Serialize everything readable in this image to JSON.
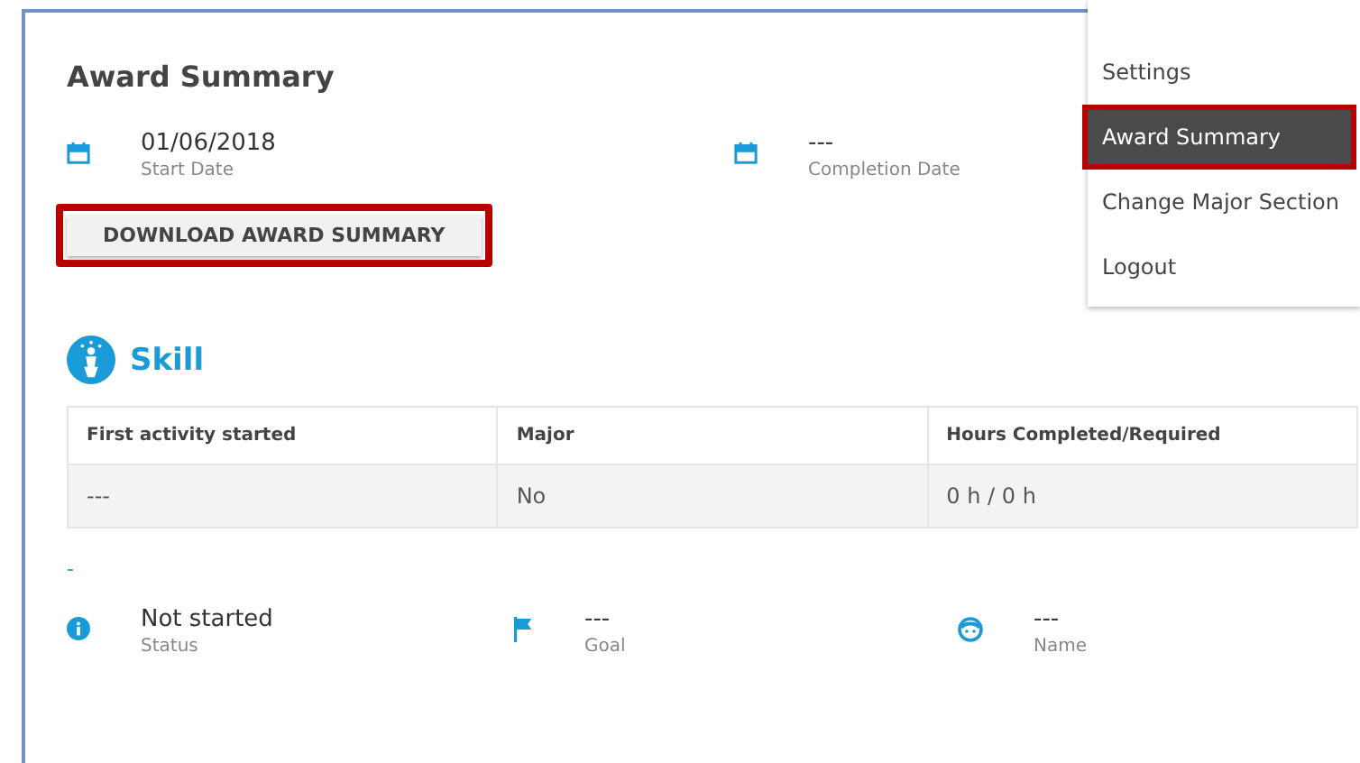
{
  "page": {
    "title": "Award Summary",
    "dates": [
      {
        "value": "01/06/2018",
        "label": "Start Date"
      },
      {
        "value": "---",
        "label": "Completion Date"
      }
    ],
    "download_button": {
      "label": "DOWNLOAD AWARD SUMMARY",
      "highlighted": true
    }
  },
  "section": {
    "title": "Skill",
    "table": {
      "columns": [
        "First activity started",
        "Major",
        "Hours Completed/Required"
      ],
      "rows": [
        [
          "---",
          "No",
          "0 h / 0 h"
        ]
      ]
    },
    "marker": "-",
    "details": [
      {
        "kind": "status",
        "value": "Not started",
        "label": "Status"
      },
      {
        "kind": "goal",
        "value": "---",
        "label": "Goal"
      },
      {
        "kind": "name",
        "value": "---",
        "label": "Name"
      }
    ]
  },
  "menu": {
    "items": [
      {
        "label": "Settings",
        "selected": false,
        "highlighted": false
      },
      {
        "label": "Award Summary",
        "selected": true,
        "highlighted": true
      },
      {
        "label": "Change Major Section",
        "selected": false,
        "highlighted": false
      },
      {
        "label": "Logout",
        "selected": false,
        "highlighted": false
      }
    ]
  }
}
